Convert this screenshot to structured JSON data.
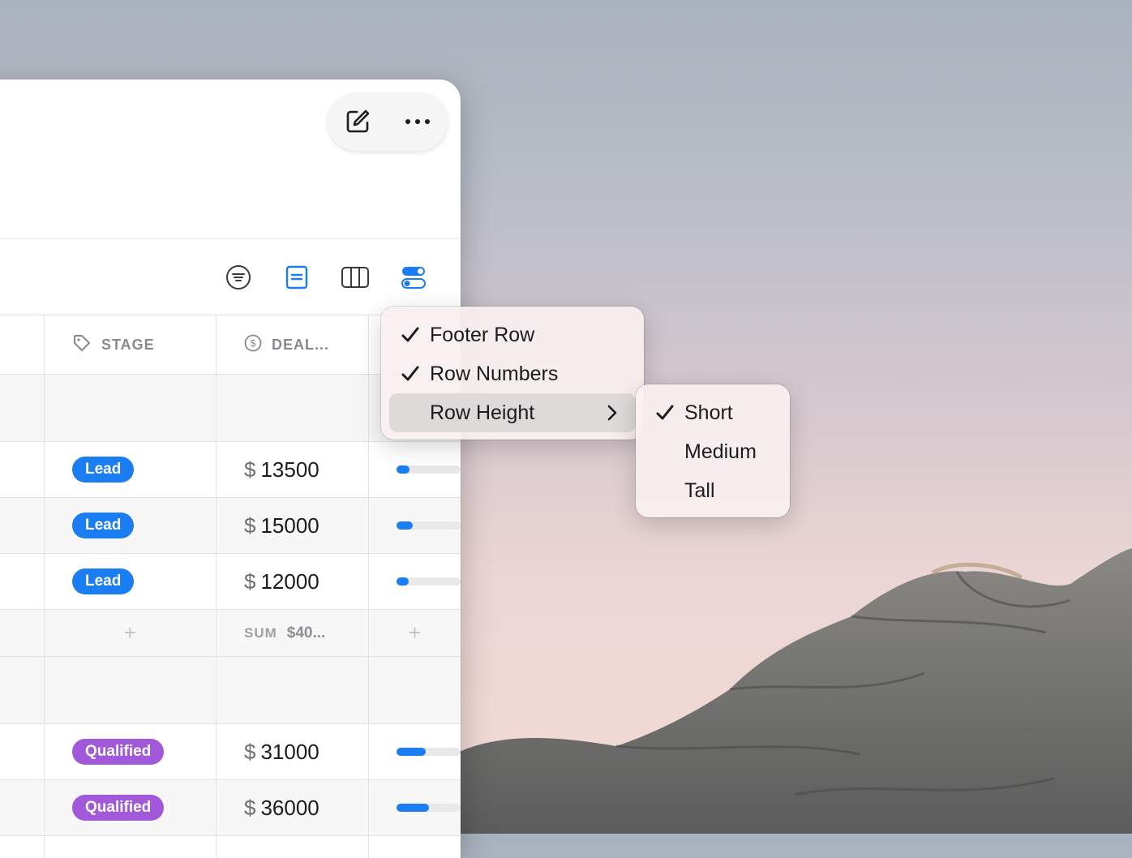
{
  "window": {
    "top_tools": {
      "compose_icon": "compose-icon",
      "more_icon": "ellipsis-icon"
    },
    "view_toolbar": [
      "filter-icon",
      "row-detail-icon",
      "columns-icon",
      "toggles-icon"
    ]
  },
  "table": {
    "columns": [
      {
        "icon": "tag-icon",
        "label": "STAGE"
      },
      {
        "icon": "dollar-circle-icon",
        "label": "DEAL..."
      }
    ],
    "group1_rows": [
      {
        "stage": "Lead",
        "currency": "$",
        "amount": "13500",
        "progress": 0.18
      },
      {
        "stage": "Lead",
        "currency": "$",
        "amount": "15000",
        "progress": 0.22
      },
      {
        "stage": "Lead",
        "currency": "$",
        "amount": "12000",
        "progress": 0.17
      }
    ],
    "footer": {
      "plus": "+",
      "sum_label": "SUM",
      "sum_value": "$40..."
    },
    "group2_rows": [
      {
        "stage": "Qualified",
        "currency": "$",
        "amount": "31000",
        "progress": 0.4
      },
      {
        "stage": "Qualified",
        "currency": "$",
        "amount": "36000",
        "progress": 0.45
      }
    ]
  },
  "menu": {
    "items": [
      {
        "label": "Footer Row",
        "checked": true
      },
      {
        "label": "Row Numbers",
        "checked": true
      },
      {
        "label": "Row Height",
        "checked": false,
        "submenu": true
      }
    ],
    "submenu": [
      {
        "label": "Short",
        "checked": true
      },
      {
        "label": "Medium",
        "checked": false
      },
      {
        "label": "Tall",
        "checked": false
      }
    ]
  },
  "colors": {
    "accent": "#1a7ef2",
    "qualified": "#a259d9"
  }
}
